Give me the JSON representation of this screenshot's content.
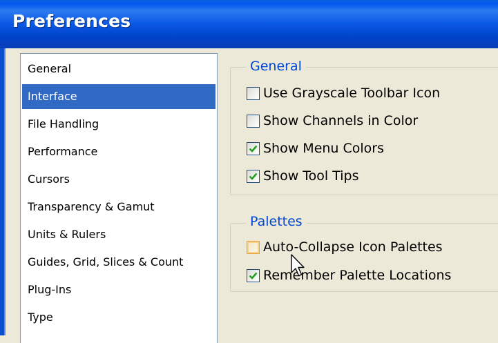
{
  "window": {
    "title": "Preferences"
  },
  "sidebar": {
    "items": [
      {
        "label": "General",
        "selected": false
      },
      {
        "label": "Interface",
        "selected": true
      },
      {
        "label": "File Handling",
        "selected": false
      },
      {
        "label": "Performance",
        "selected": false
      },
      {
        "label": "Cursors",
        "selected": false
      },
      {
        "label": "Transparency & Gamut",
        "selected": false
      },
      {
        "label": "Units & Rulers",
        "selected": false
      },
      {
        "label": "Guides, Grid, Slices & Count",
        "selected": false
      },
      {
        "label": "Plug-Ins",
        "selected": false
      },
      {
        "label": "Type",
        "selected": false
      }
    ]
  },
  "general_group": {
    "legend": "General",
    "options": [
      {
        "label": "Use Grayscale Toolbar Icon",
        "checked": false
      },
      {
        "label": "Show Channels in Color",
        "checked": false
      },
      {
        "label": "Show Menu Colors",
        "checked": true
      },
      {
        "label": "Show Tool Tips",
        "checked": true
      }
    ]
  },
  "palettes_group": {
    "legend": "Palettes",
    "options": [
      {
        "label": "Auto-Collapse Icon Palettes",
        "checked": false
      },
      {
        "label": "Remember Palette Locations",
        "checked": true
      }
    ]
  },
  "colors": {
    "title_bar": "#0058ee",
    "selection": "#316ac5",
    "legend_text": "#0046d5",
    "dialog_bg": "#ece9d8",
    "checkmark": "#21a121"
  }
}
